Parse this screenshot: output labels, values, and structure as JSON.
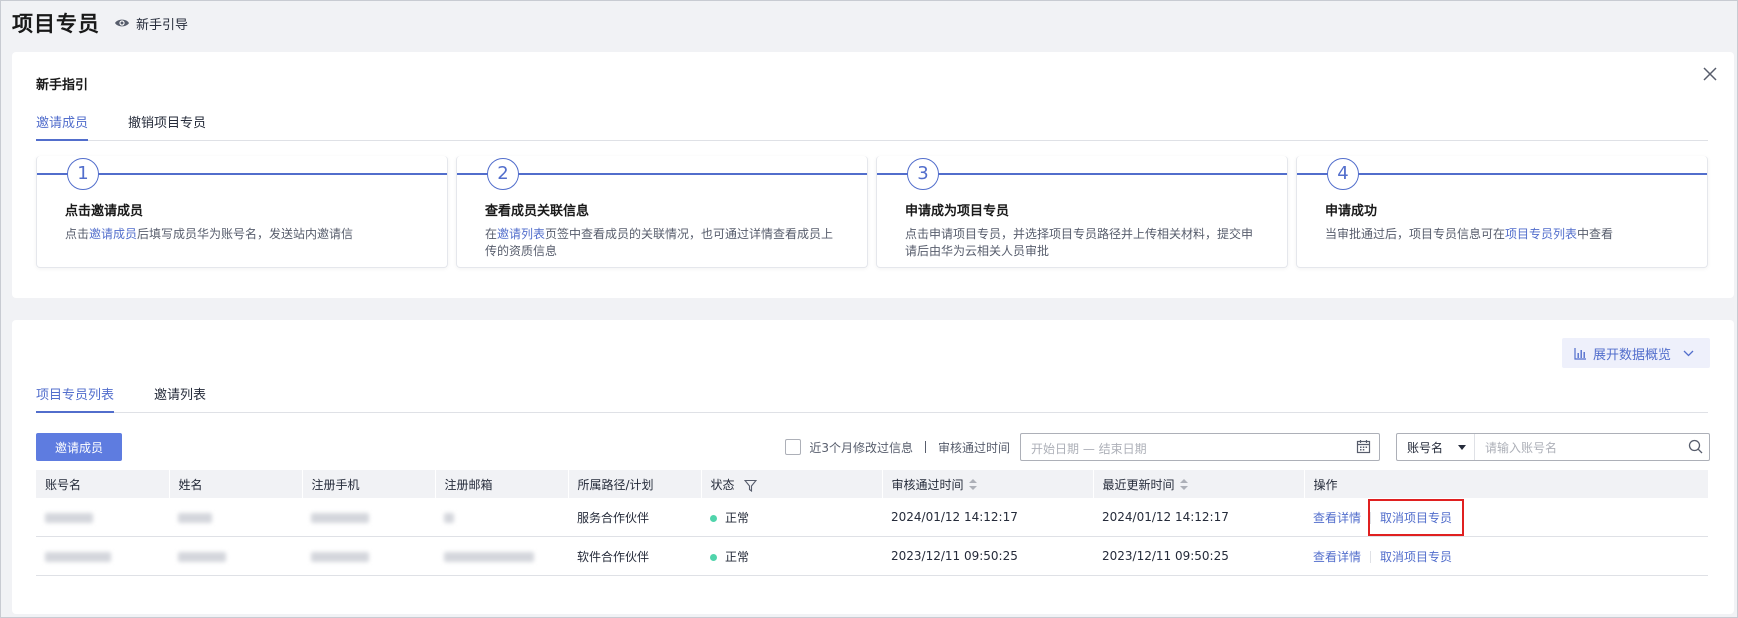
{
  "header": {
    "title": "项目专员",
    "guide_link": "新手引导"
  },
  "guide": {
    "heading": "新手指引",
    "tabs": [
      {
        "label": "邀请成员",
        "active": true
      },
      {
        "label": "撤销项目专员",
        "active": false
      }
    ],
    "steps": [
      {
        "num": "1",
        "title": "点击邀请成员",
        "desc_pre": "点击",
        "desc_link": "邀请成员",
        "desc_post": "后填写成员华为账号名，发送站内邀请信"
      },
      {
        "num": "2",
        "title": "查看成员关联信息",
        "desc_pre": "在",
        "desc_link": "邀请列表",
        "desc_post": "页签中查看成员的关联情况，也可通过详情查看成员上传的资质信息"
      },
      {
        "num": "3",
        "title": "申请成为项目专员",
        "desc_pre": "点击申请项目专员，并选择项目专员路径并上传相关材料，提交申请后由华为云相关人员审批",
        "desc_link": "",
        "desc_post": ""
      },
      {
        "num": "4",
        "title": "申请成功",
        "desc_pre": "当审批通过后，项目专员信息可在",
        "desc_link": "项目专员列表",
        "desc_post": "中查看"
      }
    ]
  },
  "list": {
    "overview_button": "展开数据概览",
    "tabs": [
      {
        "label": "项目专员列表",
        "active": true
      },
      {
        "label": "邀请列表",
        "active": false
      }
    ],
    "invite_button": "邀请成员",
    "filter": {
      "checkbox_label": "近3个月修改过信息",
      "audit_time_label": "审核通过时间",
      "date_placeholder": "开始日期 — 结束日期",
      "account_select": "账号名",
      "account_placeholder": "请输入账号名"
    },
    "columns": [
      "账号名",
      "姓名",
      "注册手机",
      "注册邮箱",
      "所属路径/计划",
      "状态",
      "审核通过时间",
      "最近更新时间",
      "操作"
    ],
    "rows": [
      {
        "path": "服务合作伙伴",
        "status": "正常",
        "approved": "2024/01/12 14:12:17",
        "updated": "2024/01/12 14:12:17",
        "op_detail": "查看详情",
        "op_cancel": "取消项目专员"
      },
      {
        "path": "软件合作伙伴",
        "status": "正常",
        "approved": "2023/12/11 09:50:25",
        "updated": "2023/12/11 09:50:25",
        "op_detail": "查看详情",
        "op_cancel": "取消项目专员"
      }
    ]
  },
  "colors": {
    "accent": "#526ecc",
    "primary_button": "#5e7ce0",
    "status_ok": "#50d4ab",
    "highlight": "#e02020"
  }
}
